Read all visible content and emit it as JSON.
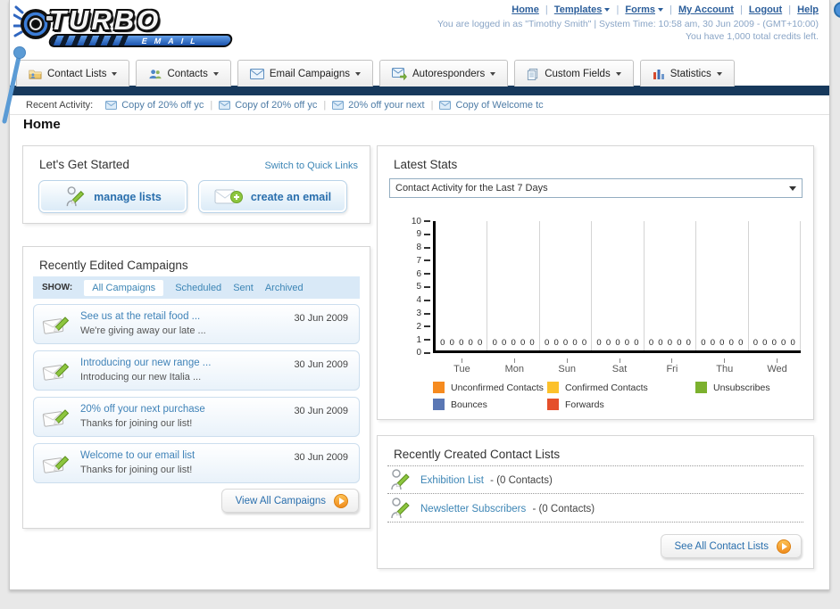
{
  "header": {
    "logo_title": "TURBO",
    "logo_subtitle": "EMAIL",
    "separator": "|",
    "nav_links": [
      {
        "label": "Home"
      },
      {
        "label": "Templates"
      },
      {
        "label": "Forms"
      },
      {
        "label": "My Account"
      },
      {
        "label": "Logout"
      },
      {
        "label": "Help"
      }
    ],
    "login_info": "You are logged in as \"Timothy Smith\" | System Time: 10:58 am, 30 Jun 2009 - (GMT+10:00)",
    "credits_info": "You have 1,000 total credits left."
  },
  "nav_tabs": [
    {
      "label": "Contact Lists"
    },
    {
      "label": "Contacts"
    },
    {
      "label": "Email Campaigns"
    },
    {
      "label": "Autoresponders"
    },
    {
      "label": "Custom Fields"
    },
    {
      "label": "Statistics"
    }
  ],
  "recent_activity": {
    "label": "Recent Activity:",
    "separator": "|",
    "items": [
      {
        "label": "Copy of 20% off yc"
      },
      {
        "label": "Copy of 20% off yc"
      },
      {
        "label": "20% off your next"
      },
      {
        "label": "Copy of Welcome tc"
      }
    ]
  },
  "page_title": "Home",
  "get_started": {
    "heading": "Let's Get Started",
    "switch_link": "Switch to Quick Links",
    "manage_lists_label": "manage lists",
    "create_email_label": "create an email"
  },
  "campaigns": {
    "heading": "Recently Edited Campaigns",
    "filter_label": "SHOW:",
    "filters": [
      {
        "label": "All Campaigns",
        "selected": true
      },
      {
        "label": "Scheduled",
        "selected": false
      },
      {
        "label": "Sent",
        "selected": false
      },
      {
        "label": "Archived",
        "selected": false
      }
    ],
    "items": [
      {
        "title": "See us at the retail food ...",
        "subtitle": "We're giving away our late ...",
        "date": "30 Jun 2009"
      },
      {
        "title": "Introducing our new range ...",
        "subtitle": "Introducing our new Italia ...",
        "date": "30 Jun 2009"
      },
      {
        "title": "20% off your next purchase",
        "subtitle": "Thanks for joining our list!",
        "date": "30 Jun 2009"
      },
      {
        "title": "Welcome to our email list",
        "subtitle": "Thanks for joining our list!",
        "date": "30 Jun 2009"
      }
    ],
    "view_all_label": "View All Campaigns"
  },
  "stats": {
    "heading": "Latest Stats",
    "period_selected": "Contact Activity for the Last 7 Days"
  },
  "chart_data": {
    "type": "bar",
    "title": "Contact Activity for the Last 7 Days",
    "categories": [
      "Tue",
      "Mon",
      "Sun",
      "Sat",
      "Fri",
      "Thu",
      "Wed"
    ],
    "series": [
      {
        "name": "Unconfirmed Contacts",
        "color": "#f68b1f",
        "values": [
          0,
          0,
          0,
          0,
          0,
          0,
          0
        ]
      },
      {
        "name": "Confirmed Contacts",
        "color": "#fcc12b",
        "values": [
          0,
          0,
          0,
          0,
          0,
          0,
          0
        ]
      },
      {
        "name": "Unsubscribes",
        "color": "#7cb12e",
        "values": [
          0,
          0,
          0,
          0,
          0,
          0,
          0
        ]
      },
      {
        "name": "Bounces",
        "color": "#5a77b4",
        "values": [
          0,
          0,
          0,
          0,
          0,
          0,
          0
        ]
      },
      {
        "name": "Forwards",
        "color": "#e54f2b",
        "values": [
          0,
          0,
          0,
          0,
          0,
          0,
          0
        ]
      }
    ],
    "ylim": [
      0,
      10
    ],
    "y_ticks": [
      0,
      1,
      2,
      3,
      4,
      5,
      6,
      7,
      8,
      9,
      10
    ],
    "xlabel": "",
    "ylabel": "",
    "grid": "vertical",
    "legend_position": "bottom"
  },
  "contact_lists": {
    "heading": "Recently Created Contact Lists",
    "items": [
      {
        "name": "Exhibition List",
        "detail": "- (0 Contacts)"
      },
      {
        "name": "Newsletter Subscribers",
        "detail": "- (0 Contacts)"
      }
    ],
    "see_all_label": "See All Contact Lists"
  }
}
